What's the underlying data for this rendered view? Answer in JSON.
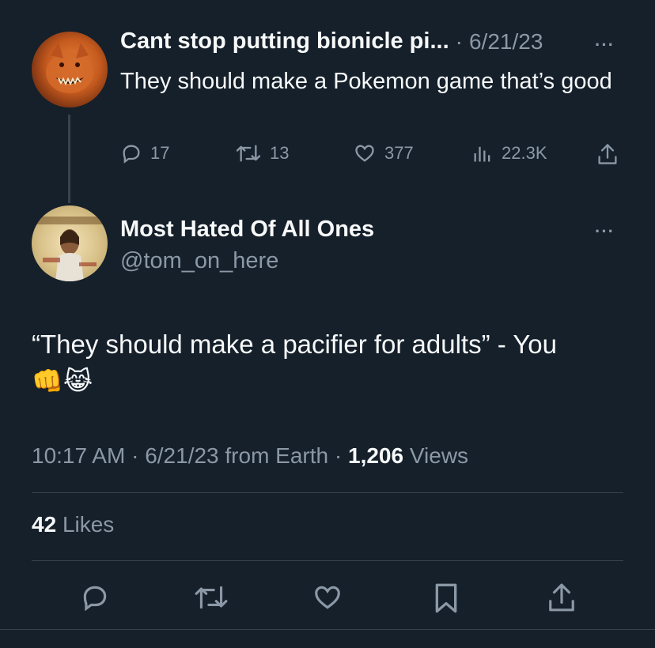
{
  "parent_tweet": {
    "author_name": "Cant stop putting bionicle pi...",
    "separator": "·",
    "date": "6/21/23",
    "more": "···",
    "text": "They should make a Pokemon game that’s good",
    "actions": {
      "replies": "17",
      "retweets": "13",
      "likes": "377",
      "views": "22.3K"
    }
  },
  "main_tweet": {
    "author_name": "Most Hated Of All Ones",
    "handle": "@tom_on_here",
    "more": "···",
    "text": "“They should make a pacifier for adults” - You",
    "emojis": "👊😹",
    "meta": {
      "time": "10:17 AM",
      "sep1": "·",
      "date": "6/21/23",
      "source": "from Earth",
      "sep2": "·",
      "views_count": "1,206",
      "views_label": "Views"
    },
    "likes": {
      "count": "42",
      "label": "Likes"
    }
  },
  "icons": {
    "reply": "speech-bubble-icon",
    "retweet": "retweet-icon",
    "like": "heart-icon",
    "views": "bar-chart-icon",
    "share": "share-icon",
    "bookmark": "bookmark-icon"
  }
}
